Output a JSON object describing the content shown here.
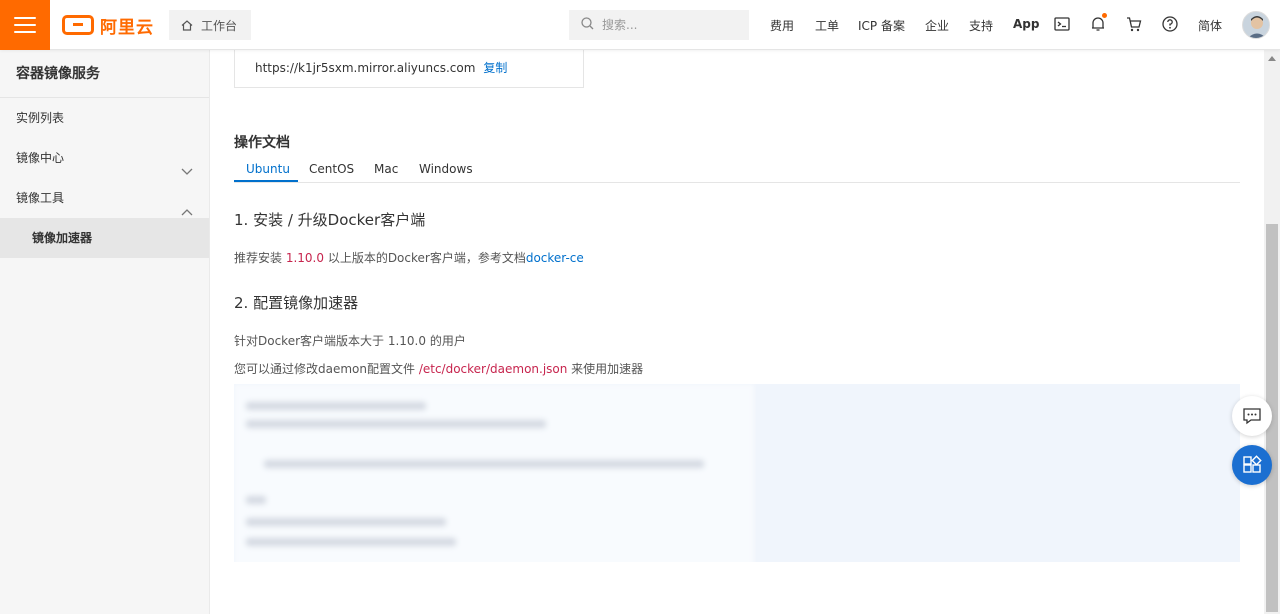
{
  "header": {
    "logo_text": "阿里云",
    "workbench_label": "工作台",
    "search_placeholder": "搜索...",
    "nav": {
      "billing": "费用",
      "ticket": "工单",
      "icp": "ICP 备案",
      "enterprise": "企业",
      "support": "支持",
      "app": "App",
      "language": "简体"
    },
    "icons": [
      "menu-icon",
      "home-icon",
      "search-icon",
      "terminal-icon",
      "bell-icon",
      "cart-icon",
      "help-icon",
      "avatar"
    ]
  },
  "sidebar": {
    "title": "容器镜像服务",
    "items": [
      {
        "label": "实例列表"
      },
      {
        "label": "镜像中心",
        "chevron": "down"
      },
      {
        "label": "镜像工具",
        "chevron": "up"
      },
      {
        "label": "镜像加速器",
        "active": true
      }
    ]
  },
  "main": {
    "accelerator": {
      "url": "https://k1jr5sxm.mirror.aliyuncs.com",
      "copy_label": "复制"
    },
    "docs_title": "操作文档",
    "tabs": [
      {
        "label": "Ubuntu",
        "active": true
      },
      {
        "label": "CentOS"
      },
      {
        "label": "Mac"
      },
      {
        "label": "Windows"
      }
    ],
    "step1": {
      "heading": "1. 安装 / 升级Docker客户端",
      "text_before": "推荐安装 ",
      "version": "1.10.0",
      "text_after": " 以上版本的Docker客户端，参考文档",
      "link": "docker-ce"
    },
    "step2": {
      "heading": "2. 配置镜像加速器",
      "line1": "针对Docker客户端版本大于 1.10.0 的用户",
      "line2_before": "您可以通过修改daemon配置文件 ",
      "config_path": "/etc/docker/daemon.json",
      "line2_after": " 来使用加速器"
    }
  },
  "colors": {
    "brand": "#ff6a00",
    "link": "#0070cc",
    "code_red": "#c7254e",
    "code_bg": "#f0f5fc",
    "float_blue": "#1b6fd1"
  }
}
